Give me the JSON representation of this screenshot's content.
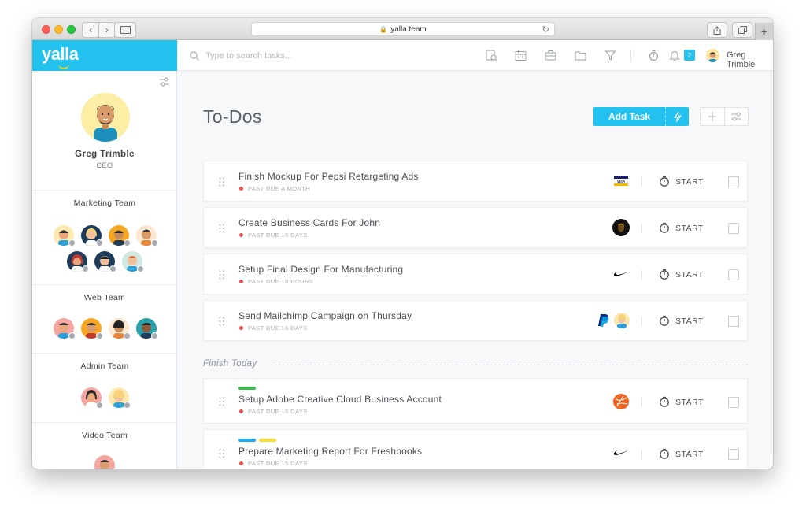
{
  "browser": {
    "url": "yalla.team"
  },
  "sidebar": {
    "logo": "yalla",
    "profile": {
      "name": "Greg Trimble",
      "role": "CEO"
    },
    "teams": [
      {
        "name": "Marketing Team"
      },
      {
        "name": "Web Team"
      },
      {
        "name": "Admin Team"
      },
      {
        "name": "Video Team"
      }
    ]
  },
  "topbar": {
    "search_placeholder": "Type to search tasks...",
    "notifications_count": "2",
    "user_name": "Greg Trimble"
  },
  "main": {
    "title": "To-Dos",
    "add_task_label": "Add Task",
    "section_label": "Finish Today",
    "start_label": "START",
    "tasks": [
      {
        "title": "Finish Mockup For Pepsi Retargeting Ads",
        "due": "PAST DUE A MONTH",
        "brand": "visa-logo"
      },
      {
        "title": "Create Business Cards For John",
        "due": "PAST DUE 16 DAYS",
        "brand": "ups-logo"
      },
      {
        "title": "Setup Final Design For Manufacturing",
        "due": "PAST DUE 18 HOURS",
        "brand": "nike-logo"
      },
      {
        "title": "Send Mailchimp Campaign on Thursday",
        "due": "PAST DUE 16 DAYS",
        "brand": "paypal-logo"
      },
      {
        "title": "Setup Adobe Creative Cloud Business Account",
        "due": "PAST DUE 16 DAYS",
        "brand": "dribbble-logo",
        "tags": [
          "#3dbb4e"
        ]
      },
      {
        "title": "Prepare Marketing Report For Freshbooks",
        "due": "PAST DUE 15 DAYS",
        "brand": "nike-logo",
        "tags": [
          "#22aaf0",
          "#f5e03a"
        ]
      }
    ]
  },
  "colors": {
    "accent": "#22c1ee",
    "overdue": "#e74c4c"
  }
}
